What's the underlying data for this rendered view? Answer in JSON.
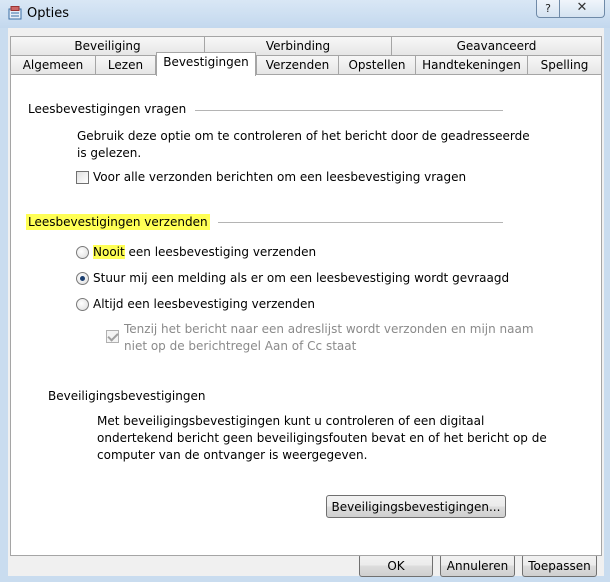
{
  "window": {
    "title": "Opties",
    "help_label": "?",
    "close_label": "✕"
  },
  "tabs_row1": [
    "Beveiliging",
    "Verbinding",
    "Geavanceerd"
  ],
  "tabs_row2": [
    "Algemeen",
    "Lezen",
    "Bevestigingen",
    "Verzenden",
    "Opstellen",
    "Handtekeningen",
    "Spelling"
  ],
  "active_tab": "Bevestigingen",
  "request_section": {
    "heading": "Leesbevestigingen vragen",
    "description_line1": "Gebruik deze optie om te controleren of het bericht door de geadresseerde",
    "description_line2": "is gelezen.",
    "checkbox_label": "Voor alle verzonden berichten om een leesbevestiging vragen",
    "checkbox_checked": false
  },
  "send_section": {
    "heading": "Leesbevestigingen verzenden",
    "option_never_highlight": "Nooit",
    "option_never_rest": " een leesbevestiging verzenden",
    "option_notify": "Stuur mij een melding als er om een leesbevestiging wordt gevraagd",
    "option_always": "Altijd een leesbevestiging verzenden",
    "selected": "notify",
    "sub_checkbox_line1": "Tenzij het bericht naar een adreslijst wordt verzonden en mijn naam",
    "sub_checkbox_line2": "niet op de berichtregel Aan of Cc staat",
    "sub_checkbox_checked": true,
    "highlight_color": "#ffff55"
  },
  "security_section": {
    "heading": "Beveiligingsbevestigingen",
    "description_line1": "Met beveiligingsbevestigingen kunt u controleren of een digitaal",
    "description_line2": "ondertekend bericht geen beveiligingsfouten bevat en of het bericht op de",
    "description_line3": "computer van de ontvanger is weergegeven.",
    "button_label": "Beveiligingsbevestigingen..."
  },
  "footer": {
    "ok": "OK",
    "cancel": "Annuleren",
    "apply": "Toepassen"
  }
}
